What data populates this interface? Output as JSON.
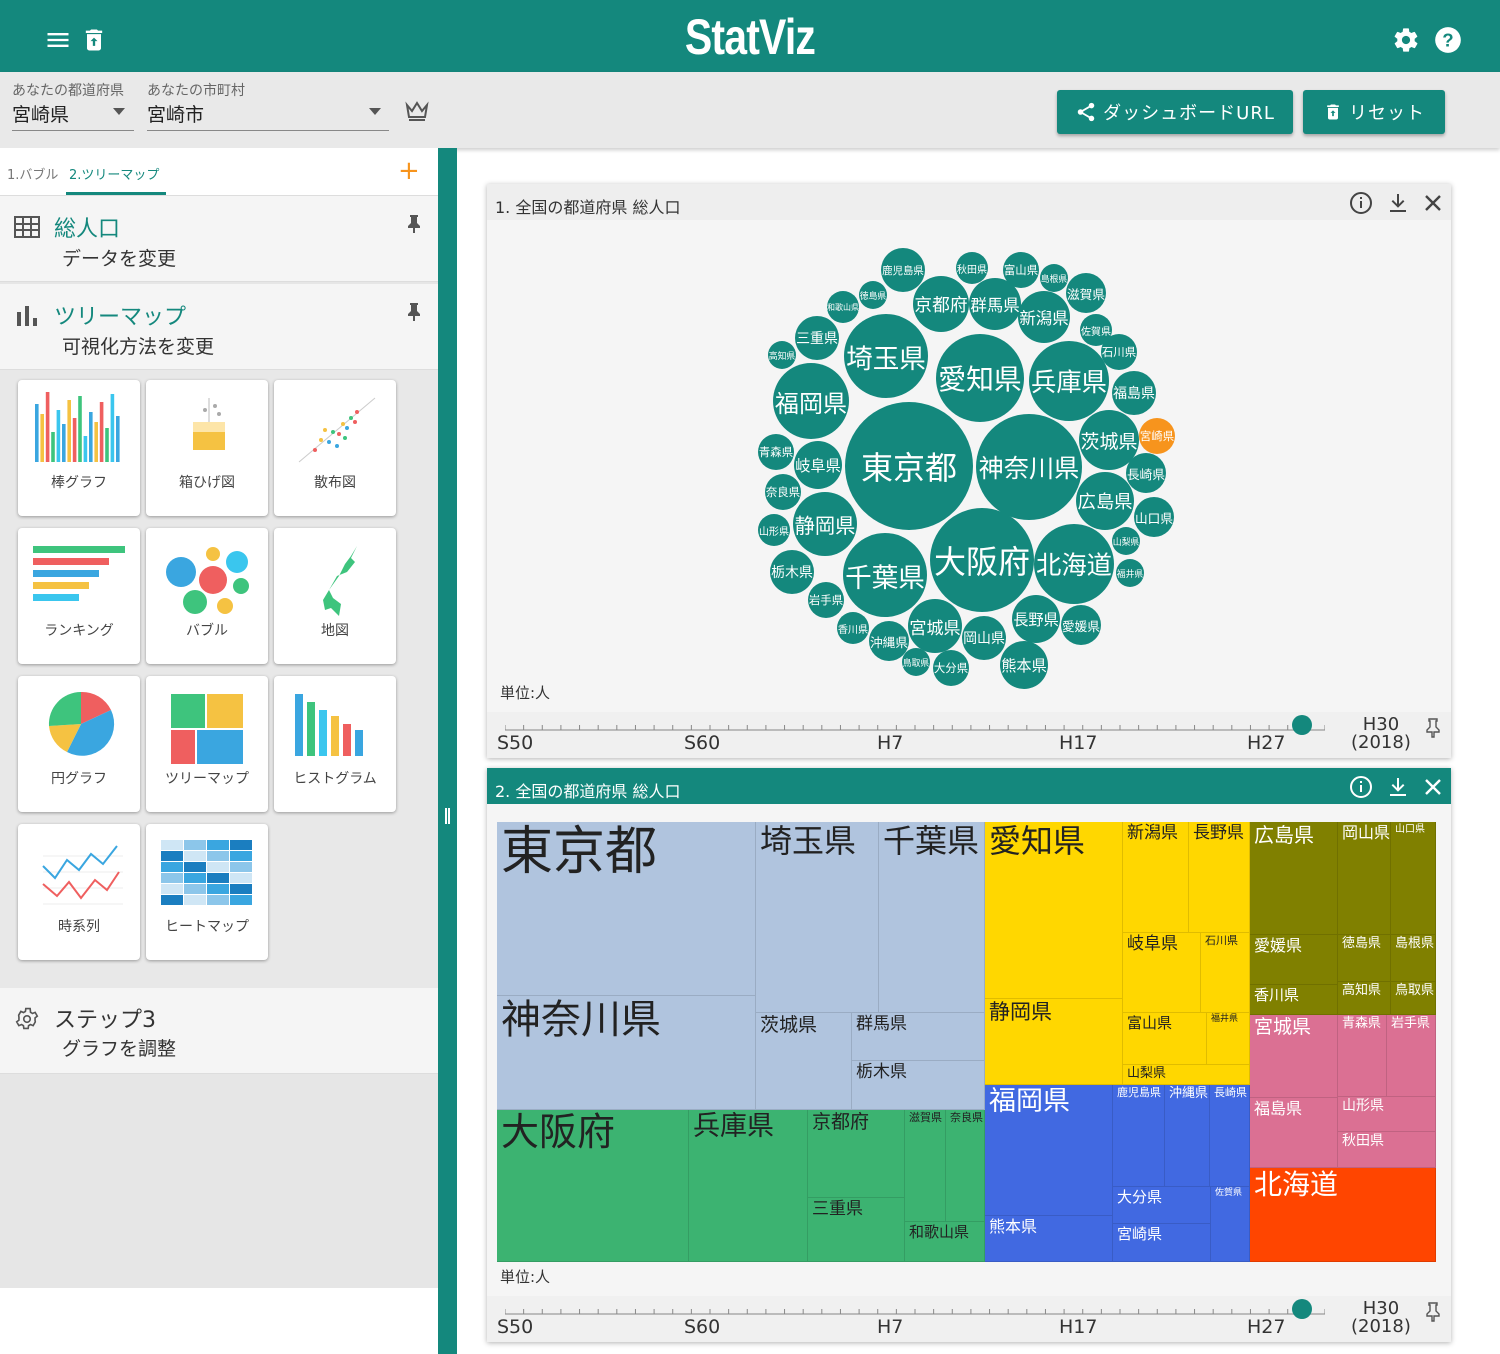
{
  "app": {
    "title": "StatViz"
  },
  "selectors": {
    "pref_label": "あなたの都道府県",
    "pref_value": "宮崎県",
    "city_label": "あなたの市町村",
    "city_value": "宮崎市"
  },
  "buttons": {
    "dashboard_url": "ダッシュボードURL",
    "reset": "リセット"
  },
  "tabs": [
    "1.バブル",
    "2.ツリーマップ"
  ],
  "steps": [
    {
      "title": "総人口",
      "sub": "データを変更"
    },
    {
      "title": "ツリーマップ",
      "sub": "可視化方法を変更"
    },
    {
      "title": "ステップ3",
      "sub": "グラフを調整"
    }
  ],
  "chart_types": [
    "棒グラフ",
    "箱ひげ図",
    "散布図",
    "ランキング",
    "バブル",
    "地図",
    "円グラフ",
    "ツリーマップ",
    "ヒストグラム",
    "時系列",
    "ヒートマップ"
  ],
  "panels": [
    {
      "title": "1. 全国の都道府県 総人口",
      "unit": "単位:人"
    },
    {
      "title": "2. 全国の都道府県 総人口",
      "unit": "単位:人"
    }
  ],
  "timeline": {
    "labels": [
      "S50",
      "S60",
      "H7",
      "H17",
      "H27"
    ],
    "current_top": "H30",
    "current_bottom": "(2018)",
    "position": 0.96
  },
  "colors": {
    "primary": "#14887d",
    "highlight": "#f7941d",
    "add": "#f7941d"
  },
  "bubble_chart": {
    "highlight": "宮崎県",
    "labels": [
      "東京都",
      "神奈川県",
      "大阪府",
      "愛知県",
      "埼玉県",
      "千葉県",
      "兵庫県",
      "北海道",
      "福岡県",
      "静岡県",
      "茨城県",
      "広島県",
      "京都府",
      "宮城県",
      "新潟県",
      "長野県",
      "岐阜県",
      "群馬県",
      "栃木県",
      "岡山県",
      "福島県",
      "三重県",
      "熊本県",
      "鹿児島県",
      "沖縄県",
      "滋賀県",
      "山口県",
      "愛媛県",
      "長崎県",
      "奈良県",
      "青森県",
      "岩手県",
      "大分県",
      "石川県",
      "山形県",
      "宮崎県",
      "富山県",
      "秋田県",
      "香川県",
      "和歌山県",
      "佐賀県",
      "山梨県",
      "福井県",
      "徳島県",
      "高知県",
      "島根県",
      "鳥取県"
    ]
  },
  "treemap": {
    "labels": [
      "東京都",
      "神奈川県",
      "埼玉県",
      "千葉県",
      "茨城県",
      "群馬県",
      "栃木県",
      "大阪府",
      "兵庫県",
      "京都府",
      "三重県",
      "滋賀県",
      "奈良県",
      "和歌山県",
      "愛知県",
      "静岡県",
      "新潟県",
      "長野県",
      "岐阜県",
      "石川県",
      "富山県",
      "福井県",
      "山梨県",
      "福岡県",
      "熊本県",
      "鹿児島県",
      "沖縄県",
      "長崎県",
      "大分県",
      "宮崎県",
      "佐賀県",
      "広島県",
      "岡山県",
      "山口県",
      "愛媛県",
      "徳島県",
      "島根県",
      "香川県",
      "高知県",
      "鳥取県",
      "宮城県",
      "青森県",
      "岩手県",
      "福島県",
      "山形県",
      "秋田県",
      "北海道"
    ]
  }
}
